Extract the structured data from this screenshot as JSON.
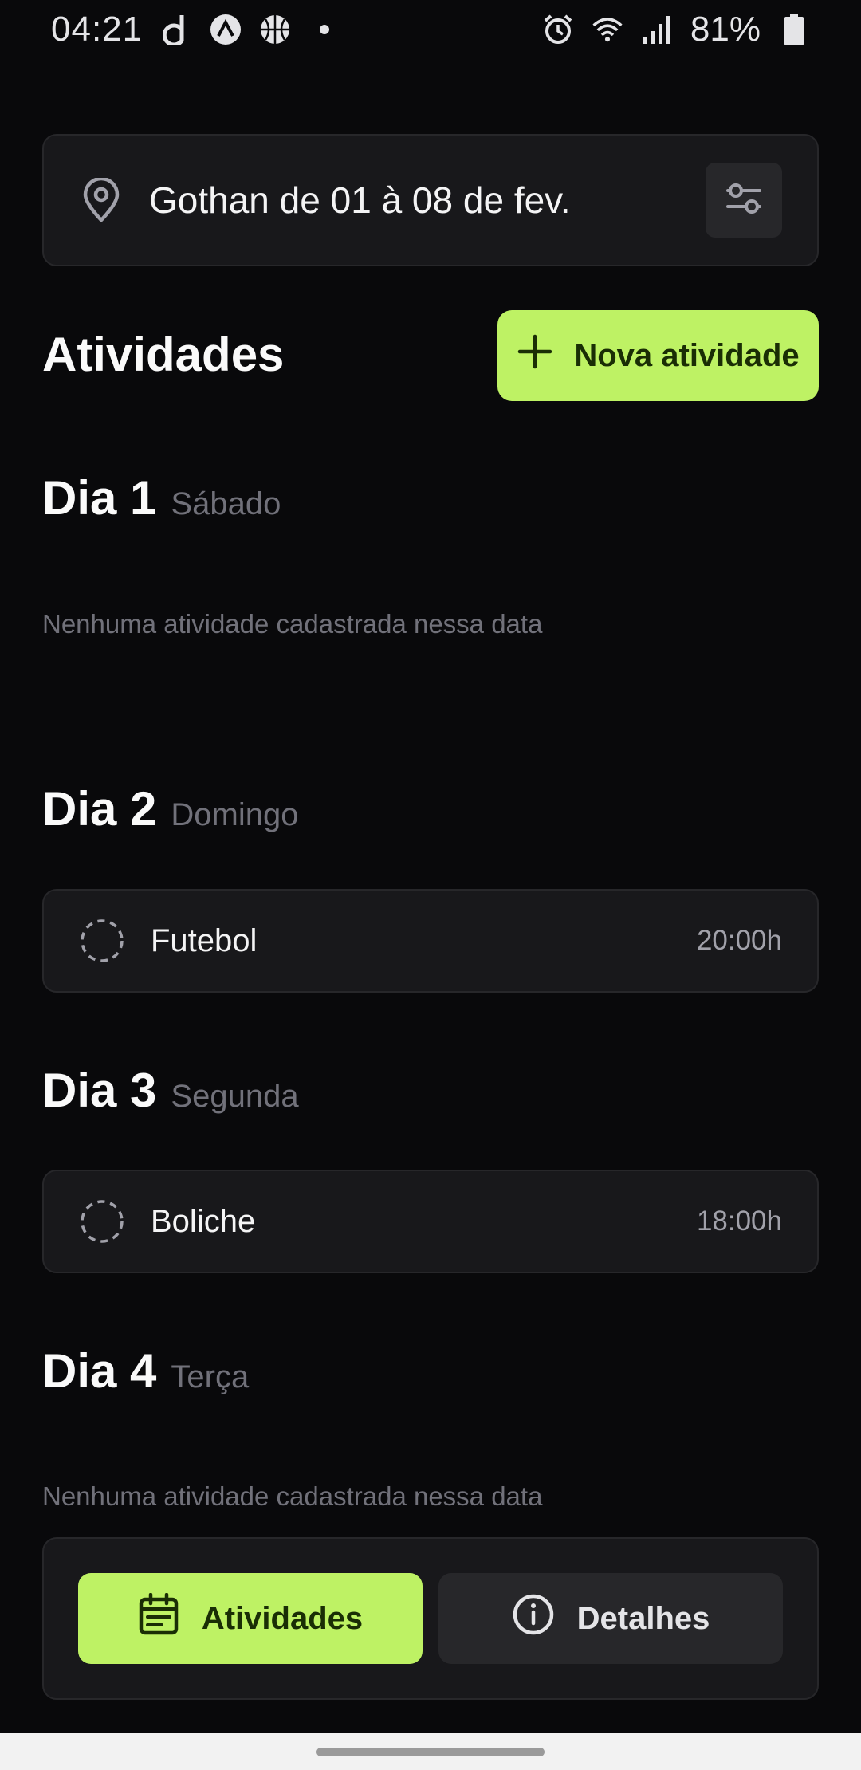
{
  "status_bar": {
    "time": "04:21",
    "app_icons": [
      "d-icon",
      "arrow-up-circle-icon",
      "basketball-icon"
    ],
    "right_icons": [
      "alarm-icon",
      "wifi-icon",
      "signal-icon"
    ],
    "battery": "81%"
  },
  "destination": {
    "text": "Gothan de 01 à 08 de fev.",
    "icon": "map-pin-icon",
    "settings_icon": "sliders-icon"
  },
  "header": {
    "title": "Atividades",
    "new_activity_label": "Nova atividade"
  },
  "days": [
    {
      "title": "Dia 1",
      "weekday": "Sábado",
      "empty_message": "Nenhuma atividade cadastrada nessa data"
    },
    {
      "title": "Dia 2",
      "weekday": "Domingo",
      "activities": [
        {
          "name": "Futebol",
          "time": "20:00h"
        }
      ]
    },
    {
      "title": "Dia 3",
      "weekday": "Segunda",
      "activities": [
        {
          "name": "Boliche",
          "time": "18:00h"
        }
      ]
    },
    {
      "title": "Dia 4",
      "weekday": "Terça",
      "empty_message": "Nenhuma atividade cadastrada nessa data"
    }
  ],
  "tabs": [
    {
      "label": "Atividades",
      "icon": "calendar-icon",
      "active": true
    },
    {
      "label": "Detalhes",
      "icon": "info-icon",
      "active": false
    }
  ],
  "colors": {
    "background": "#09090b",
    "card": "#18181b",
    "accent": "#bef264",
    "muted_text": "#71717a"
  }
}
